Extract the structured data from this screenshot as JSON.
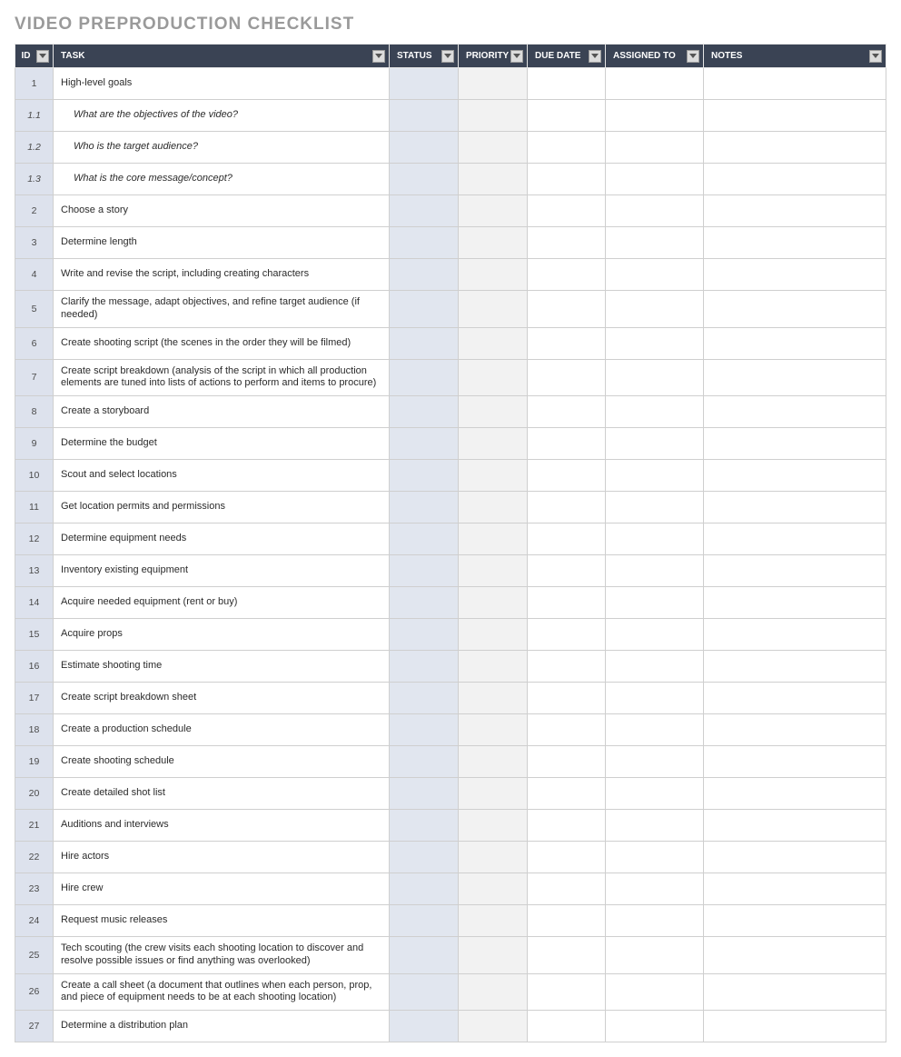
{
  "title": "VIDEO PREPRODUCTION CHECKLIST",
  "columns": [
    {
      "key": "id",
      "label": "ID"
    },
    {
      "key": "task",
      "label": "TASK"
    },
    {
      "key": "status",
      "label": "STATUS"
    },
    {
      "key": "priority",
      "label": "PRIORITY"
    },
    {
      "key": "duedate",
      "label": "DUE DATE"
    },
    {
      "key": "assigned",
      "label": "ASSIGNED TO"
    },
    {
      "key": "notes",
      "label": "NOTES"
    }
  ],
  "rows": [
    {
      "id": "1",
      "sub": false,
      "task": "High-level goals",
      "status": "",
      "priority": "",
      "duedate": "",
      "assigned": "",
      "notes": ""
    },
    {
      "id": "1.1",
      "sub": true,
      "task": "What are the objectives of the video?",
      "status": "",
      "priority": "",
      "duedate": "",
      "assigned": "",
      "notes": ""
    },
    {
      "id": "1.2",
      "sub": true,
      "task": "Who is the target audience?",
      "status": "",
      "priority": "",
      "duedate": "",
      "assigned": "",
      "notes": ""
    },
    {
      "id": "1.3",
      "sub": true,
      "task": "What is the core message/concept?",
      "status": "",
      "priority": "",
      "duedate": "",
      "assigned": "",
      "notes": ""
    },
    {
      "id": "2",
      "sub": false,
      "task": "Choose a story",
      "status": "",
      "priority": "",
      "duedate": "",
      "assigned": "",
      "notes": ""
    },
    {
      "id": "3",
      "sub": false,
      "task": "Determine length",
      "status": "",
      "priority": "",
      "duedate": "",
      "assigned": "",
      "notes": ""
    },
    {
      "id": "4",
      "sub": false,
      "task": "Write and revise the script, including creating characters",
      "status": "",
      "priority": "",
      "duedate": "",
      "assigned": "",
      "notes": ""
    },
    {
      "id": "5",
      "sub": false,
      "task": "Clarify the message, adapt objectives, and refine target audience (if needed)",
      "status": "",
      "priority": "",
      "duedate": "",
      "assigned": "",
      "notes": ""
    },
    {
      "id": "6",
      "sub": false,
      "task": "Create shooting script (the scenes in the order they will be filmed)",
      "status": "",
      "priority": "",
      "duedate": "",
      "assigned": "",
      "notes": ""
    },
    {
      "id": "7",
      "sub": false,
      "task": "Create script breakdown (analysis of the script in which all production elements are tuned into lists of actions to perform and items to procure)",
      "status": "",
      "priority": "",
      "duedate": "",
      "assigned": "",
      "notes": ""
    },
    {
      "id": "8",
      "sub": false,
      "task": "Create a storyboard",
      "status": "",
      "priority": "",
      "duedate": "",
      "assigned": "",
      "notes": ""
    },
    {
      "id": "9",
      "sub": false,
      "task": "Determine the budget",
      "status": "",
      "priority": "",
      "duedate": "",
      "assigned": "",
      "notes": ""
    },
    {
      "id": "10",
      "sub": false,
      "task": "Scout and select locations",
      "status": "",
      "priority": "",
      "duedate": "",
      "assigned": "",
      "notes": ""
    },
    {
      "id": "11",
      "sub": false,
      "task": "Get location permits and permissions",
      "status": "",
      "priority": "",
      "duedate": "",
      "assigned": "",
      "notes": ""
    },
    {
      "id": "12",
      "sub": false,
      "task": "Determine equipment needs",
      "status": "",
      "priority": "",
      "duedate": "",
      "assigned": "",
      "notes": ""
    },
    {
      "id": "13",
      "sub": false,
      "task": "Inventory existing equipment",
      "status": "",
      "priority": "",
      "duedate": "",
      "assigned": "",
      "notes": ""
    },
    {
      "id": "14",
      "sub": false,
      "task": "Acquire needed equipment (rent or buy)",
      "status": "",
      "priority": "",
      "duedate": "",
      "assigned": "",
      "notes": ""
    },
    {
      "id": "15",
      "sub": false,
      "task": "Acquire props",
      "status": "",
      "priority": "",
      "duedate": "",
      "assigned": "",
      "notes": ""
    },
    {
      "id": "16",
      "sub": false,
      "task": "Estimate shooting time",
      "status": "",
      "priority": "",
      "duedate": "",
      "assigned": "",
      "notes": ""
    },
    {
      "id": "17",
      "sub": false,
      "task": "Create script breakdown sheet",
      "status": "",
      "priority": "",
      "duedate": "",
      "assigned": "",
      "notes": ""
    },
    {
      "id": "18",
      "sub": false,
      "task": "Create a production schedule",
      "status": "",
      "priority": "",
      "duedate": "",
      "assigned": "",
      "notes": ""
    },
    {
      "id": "19",
      "sub": false,
      "task": "Create shooting schedule",
      "status": "",
      "priority": "",
      "duedate": "",
      "assigned": "",
      "notes": ""
    },
    {
      "id": "20",
      "sub": false,
      "task": "Create detailed shot list",
      "status": "",
      "priority": "",
      "duedate": "",
      "assigned": "",
      "notes": ""
    },
    {
      "id": "21",
      "sub": false,
      "task": "Auditions and interviews",
      "status": "",
      "priority": "",
      "duedate": "",
      "assigned": "",
      "notes": ""
    },
    {
      "id": "22",
      "sub": false,
      "task": "Hire actors",
      "status": "",
      "priority": "",
      "duedate": "",
      "assigned": "",
      "notes": ""
    },
    {
      "id": "23",
      "sub": false,
      "task": "Hire crew",
      "status": "",
      "priority": "",
      "duedate": "",
      "assigned": "",
      "notes": ""
    },
    {
      "id": "24",
      "sub": false,
      "task": "Request music releases",
      "status": "",
      "priority": "",
      "duedate": "",
      "assigned": "",
      "notes": ""
    },
    {
      "id": "25",
      "sub": false,
      "task": "Tech scouting (the crew visits each shooting location to discover and resolve possible issues or find anything was overlooked)",
      "status": "",
      "priority": "",
      "duedate": "",
      "assigned": "",
      "notes": ""
    },
    {
      "id": "26",
      "sub": false,
      "task": "Create a call sheet (a document that outlines when each person, prop, and piece of equipment needs to be at each shooting location)",
      "status": "",
      "priority": "",
      "duedate": "",
      "assigned": "",
      "notes": ""
    },
    {
      "id": "27",
      "sub": false,
      "task": "Determine a distribution plan",
      "status": "",
      "priority": "",
      "duedate": "",
      "assigned": "",
      "notes": ""
    }
  ]
}
